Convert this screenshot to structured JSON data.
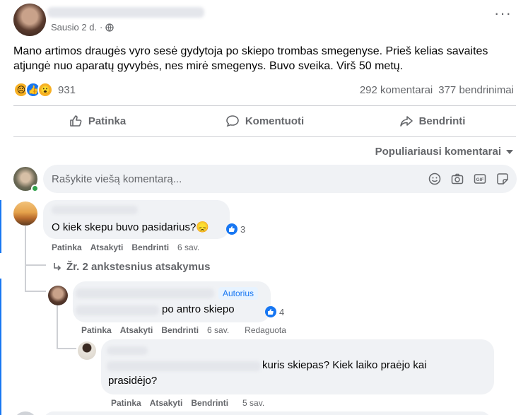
{
  "post": {
    "date": "Sausio 2 d.",
    "dot": "·",
    "text": "Mano artimos draugės vyro sesė gydytoja po skiepo trombas smegenyse. Prieš kelias savaites atjungė nuo aparatų gyvybės, nes mirė smegenys. Buvo sveika. Virš 50 metų.",
    "reaction_count": "931",
    "comments_count": "292 komentarai",
    "shares_count": "377 bendrinimai",
    "reactions": [
      "sad",
      "like",
      "wow"
    ]
  },
  "actions": {
    "like": "Patinka",
    "comment": "Komentuoti",
    "share": "Bendrinti"
  },
  "sort_label": "Populiariausi komentarai",
  "comment_input": {
    "placeholder": "Rašykite viešą komentarą..."
  },
  "comments": [
    {
      "text": "O kiek skepu buvo pasidarius?",
      "emoji": "😞",
      "likes": "3",
      "like": "Patinka",
      "reply": "Atsakyti",
      "share": "Bendrinti",
      "time": "6 sav."
    }
  ],
  "view_replies": "Žr. 2 ankstesnius atsakymus",
  "reply1": {
    "badge": "Autorius",
    "text": "po antro skiepo",
    "likes": "4",
    "like": "Patinka",
    "reply": "Atsakyti",
    "share": "Bendrinti",
    "time": "6 sav.",
    "edited": "Redaguota"
  },
  "reply2": {
    "text_line1": "kuris skiepas? Kiek laiko praėjo kai",
    "text_line2": "prasidėjo?",
    "like": "Patinka",
    "reply": "Atsakyti",
    "share": "Bendrinti",
    "time": "5 sav."
  },
  "colors": {
    "accent": "#1877f2",
    "secondary_text": "#65676b",
    "bubble": "#f0f2f5"
  }
}
